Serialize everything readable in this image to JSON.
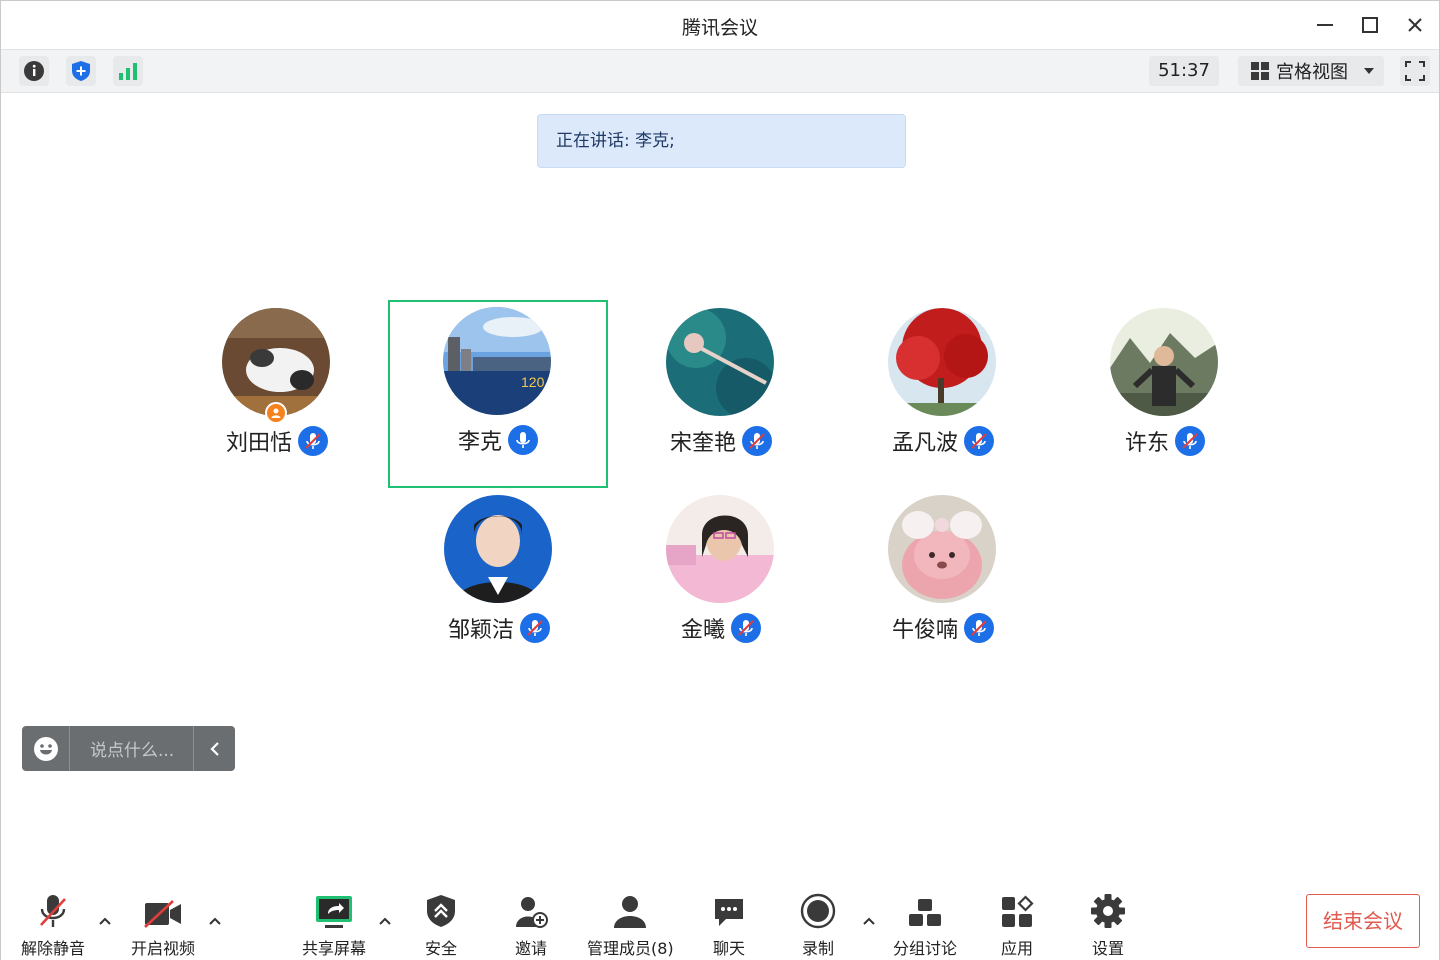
{
  "window": {
    "title": "腾讯会议"
  },
  "toolbar": {
    "info_icon": "info-icon",
    "shield_icon": "shield-plus-icon",
    "signal_icon": "signal-bars-icon",
    "timer": "51:37",
    "view_label": "宫格视图",
    "fullscreen_icon": "fullscreen-icon"
  },
  "speaking": {
    "text": "正在讲话: 李克;"
  },
  "participants": [
    {
      "name": "刘田恬",
      "mic": "muted",
      "host": true
    },
    {
      "name": "李克",
      "mic": "on",
      "active": true
    },
    {
      "name": "宋奎艳",
      "mic": "muted"
    },
    {
      "name": "孟凡波",
      "mic": "muted"
    },
    {
      "name": "许东",
      "mic": "muted"
    },
    {
      "name": "邹颖洁",
      "mic": "muted"
    },
    {
      "name": "金曦",
      "mic": "muted"
    },
    {
      "name": "牛俊喃",
      "mic": "muted"
    }
  ],
  "chat": {
    "placeholder": "说点什么..."
  },
  "bottombar": {
    "unmute": "解除静音",
    "video": "开启视频",
    "share": "共享屏幕",
    "security": "安全",
    "invite": "邀请",
    "members": "管理成员(8)",
    "chat": "聊天",
    "record": "录制",
    "breakout": "分组讨论",
    "apps": "应用",
    "settings": "设置",
    "end": "结束会议"
  },
  "colors": {
    "accent_blue": "#1d6fe8",
    "active_green": "#1fc071",
    "end_red": "#e05a4f",
    "host_orange": "#f5811f"
  }
}
